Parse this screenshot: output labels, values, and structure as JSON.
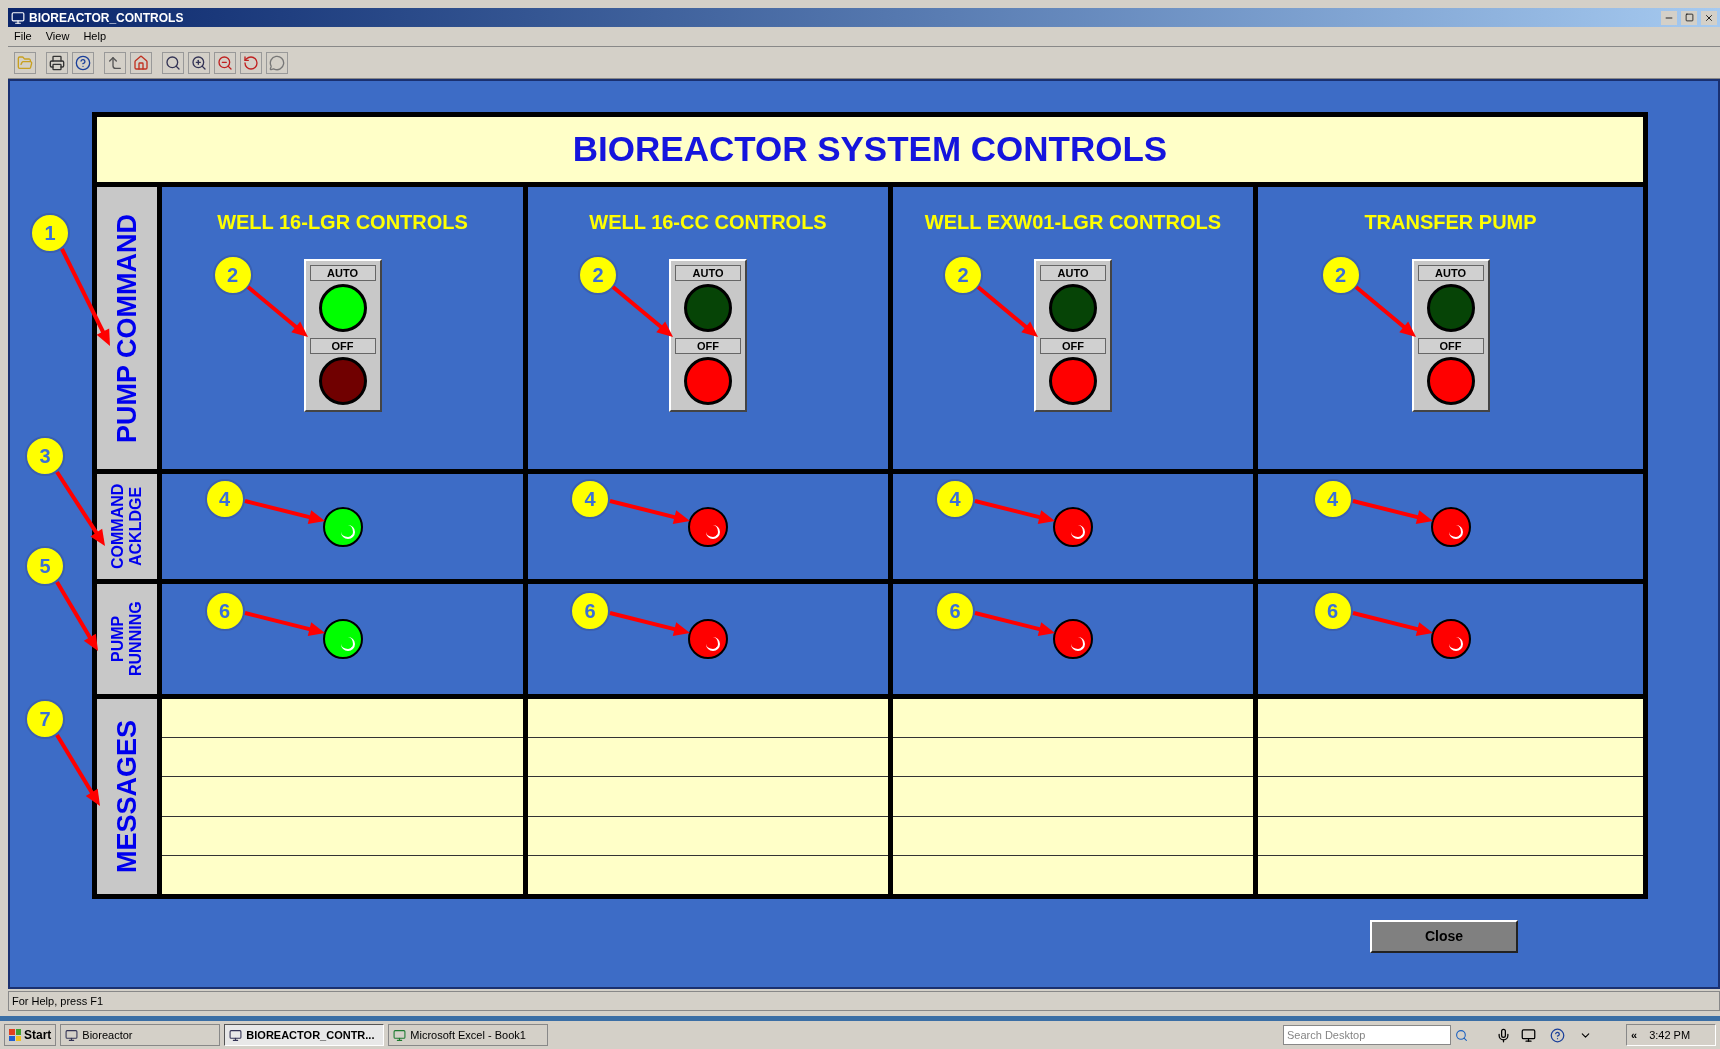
{
  "window": {
    "title": "BIOREACTOR_CONTROLS"
  },
  "menu": [
    "File",
    "View",
    "Help"
  ],
  "panel": {
    "title": "BIOREACTOR SYSTEM CONTROLS",
    "row_labels": [
      {
        "text": "PUMP COMMAND",
        "callout": "1"
      },
      {
        "text": "COMMAND ACKLDGE",
        "callout": "3"
      },
      {
        "text": "PUMP RUNNING",
        "callout": "5"
      },
      {
        "text": "MESSAGES",
        "callout": "7"
      }
    ],
    "columns": [
      {
        "title": "WELL 16-LGR CONTROLS",
        "pump_callout": "2",
        "auto_label": "AUTO",
        "auto_on": true,
        "off_label": "OFF",
        "off_on": false,
        "ack_callout": "4",
        "ack_on": true,
        "run_callout": "6",
        "running": true
      },
      {
        "title": "WELL 16-CC CONTROLS",
        "pump_callout": "2",
        "auto_label": "AUTO",
        "auto_on": false,
        "off_label": "OFF",
        "off_on": true,
        "ack_callout": "4",
        "ack_on": false,
        "run_callout": "6",
        "running": false
      },
      {
        "title": "WELL EXW01-LGR CONTROLS",
        "pump_callout": "2",
        "auto_label": "AUTO",
        "auto_on": false,
        "off_label": "OFF",
        "off_on": true,
        "ack_callout": "4",
        "ack_on": false,
        "run_callout": "6",
        "running": false
      },
      {
        "title": "TRANSFER PUMP",
        "pump_callout": "2",
        "auto_label": "AUTO",
        "auto_on": false,
        "off_label": "OFF",
        "off_on": true,
        "ack_callout": "4",
        "ack_on": false,
        "run_callout": "6",
        "running": false
      }
    ]
  },
  "close_button": "Close",
  "status_bar": "For Help, press F1",
  "taskbar": {
    "start": "Start",
    "tasks": [
      {
        "label": "Bioreactor",
        "selected": false
      },
      {
        "label": "BIOREACTOR_CONTR...",
        "selected": true
      },
      {
        "label": "Microsoft Excel - Book1",
        "selected": false
      }
    ],
    "search": {
      "placeholder": "Search Desktop"
    },
    "chevron": "«",
    "clock": "3:42 PM"
  }
}
